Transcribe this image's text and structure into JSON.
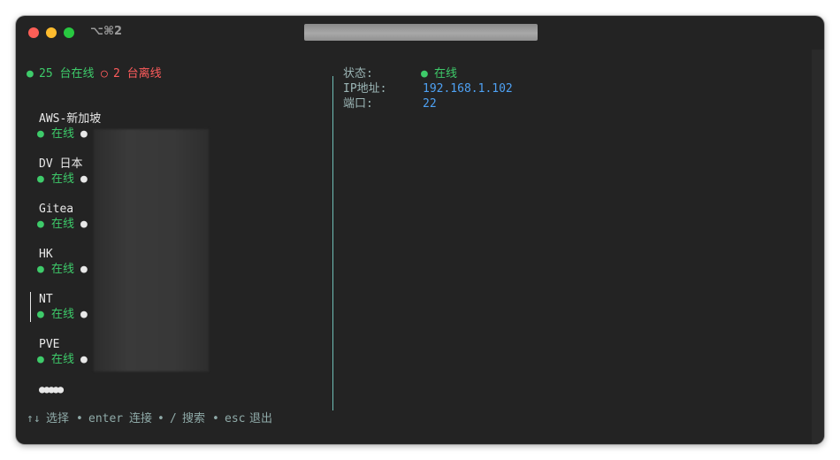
{
  "titlebar": {
    "tab_label": "⌥⌘2"
  },
  "summary": {
    "online_dot": "●",
    "online_text": "25 台在线",
    "offline_dot": "○",
    "offline_text": "2 台离线"
  },
  "servers": [
    {
      "name": "AWS-新加坡",
      "status_dot": "●",
      "status": "在线",
      "bullet": "●"
    },
    {
      "name": "DV 日本",
      "status_dot": "●",
      "status": "在线",
      "bullet": "●"
    },
    {
      "name": "Gitea",
      "status_dot": "●",
      "status": "在线",
      "bullet": "●"
    },
    {
      "name": "HK",
      "status_dot": "●",
      "status": "在线",
      "bullet": "●"
    },
    {
      "name": "NT",
      "status_dot": "●",
      "status": "在线",
      "bullet": "●",
      "selected": true
    },
    {
      "name": "PVE",
      "status_dot": "●",
      "status": "在线",
      "bullet": "●"
    }
  ],
  "pagination": "●●●●●",
  "details": {
    "status_label": "状态:",
    "status_dot": "●",
    "status_value": "在线",
    "ip_label": "IP地址:",
    "ip_value": "192.168.1.102",
    "port_label": "端口:",
    "port_value": "22"
  },
  "help": {
    "select_keys": "↑↓",
    "select_label": "选择",
    "sep1": "•",
    "enter_key": "enter",
    "enter_label": "连接",
    "sep2": "•",
    "search_key": "/",
    "search_label": "搜索",
    "sep3": "•",
    "esc_key": "esc",
    "esc_label": "退出"
  },
  "colors": {
    "background": "#232323",
    "online": "#3ecb6a",
    "offline": "#ff5c5c",
    "value": "#4ea1f3",
    "divider": "#6fbdb5"
  }
}
